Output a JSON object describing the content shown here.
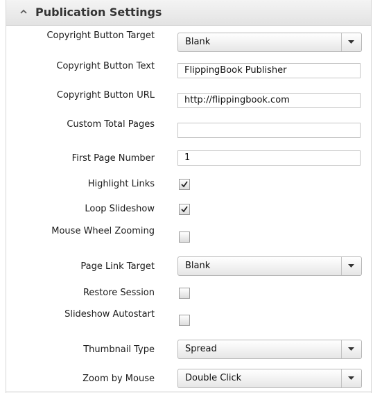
{
  "panel": {
    "title": "Publication Settings",
    "collapse_icon": "chevron-up-icon"
  },
  "fields": {
    "copyright_button_target": {
      "label": "Copyright Button Target",
      "value": "Blank"
    },
    "copyright_button_text": {
      "label": "Copyright Button Text",
      "value": "FlippingBook Publisher"
    },
    "copyright_button_url": {
      "label": "Copyright Button URL",
      "value": "http://flippingbook.com"
    },
    "custom_total_pages": {
      "label": "Custom Total Pages",
      "value": ""
    },
    "first_page_number": {
      "label": "First Page Number",
      "value": "1"
    },
    "highlight_links": {
      "label": "Highlight Links",
      "checked": true
    },
    "loop_slideshow": {
      "label": "Loop Slideshow",
      "checked": true
    },
    "mouse_wheel_zooming": {
      "label": "Mouse Wheel Zooming",
      "checked": false
    },
    "page_link_target": {
      "label": "Page Link Target",
      "value": "Blank"
    },
    "restore_session": {
      "label": "Restore Session",
      "checked": false
    },
    "slideshow_autostart": {
      "label": "Slideshow Autostart",
      "checked": false
    },
    "thumbnail_type": {
      "label": "Thumbnail Type",
      "value": "Spread"
    },
    "zoom_by_mouse": {
      "label": "Zoom by Mouse",
      "value": "Double Click"
    }
  },
  "icons": {
    "dropdown_arrow": "chevron-down-icon",
    "checkmark": "checkmark-icon"
  },
  "colors": {
    "header_bg": "#e6e6e6",
    "border": "#c4c4c4",
    "text": "#1a1a1a"
  }
}
